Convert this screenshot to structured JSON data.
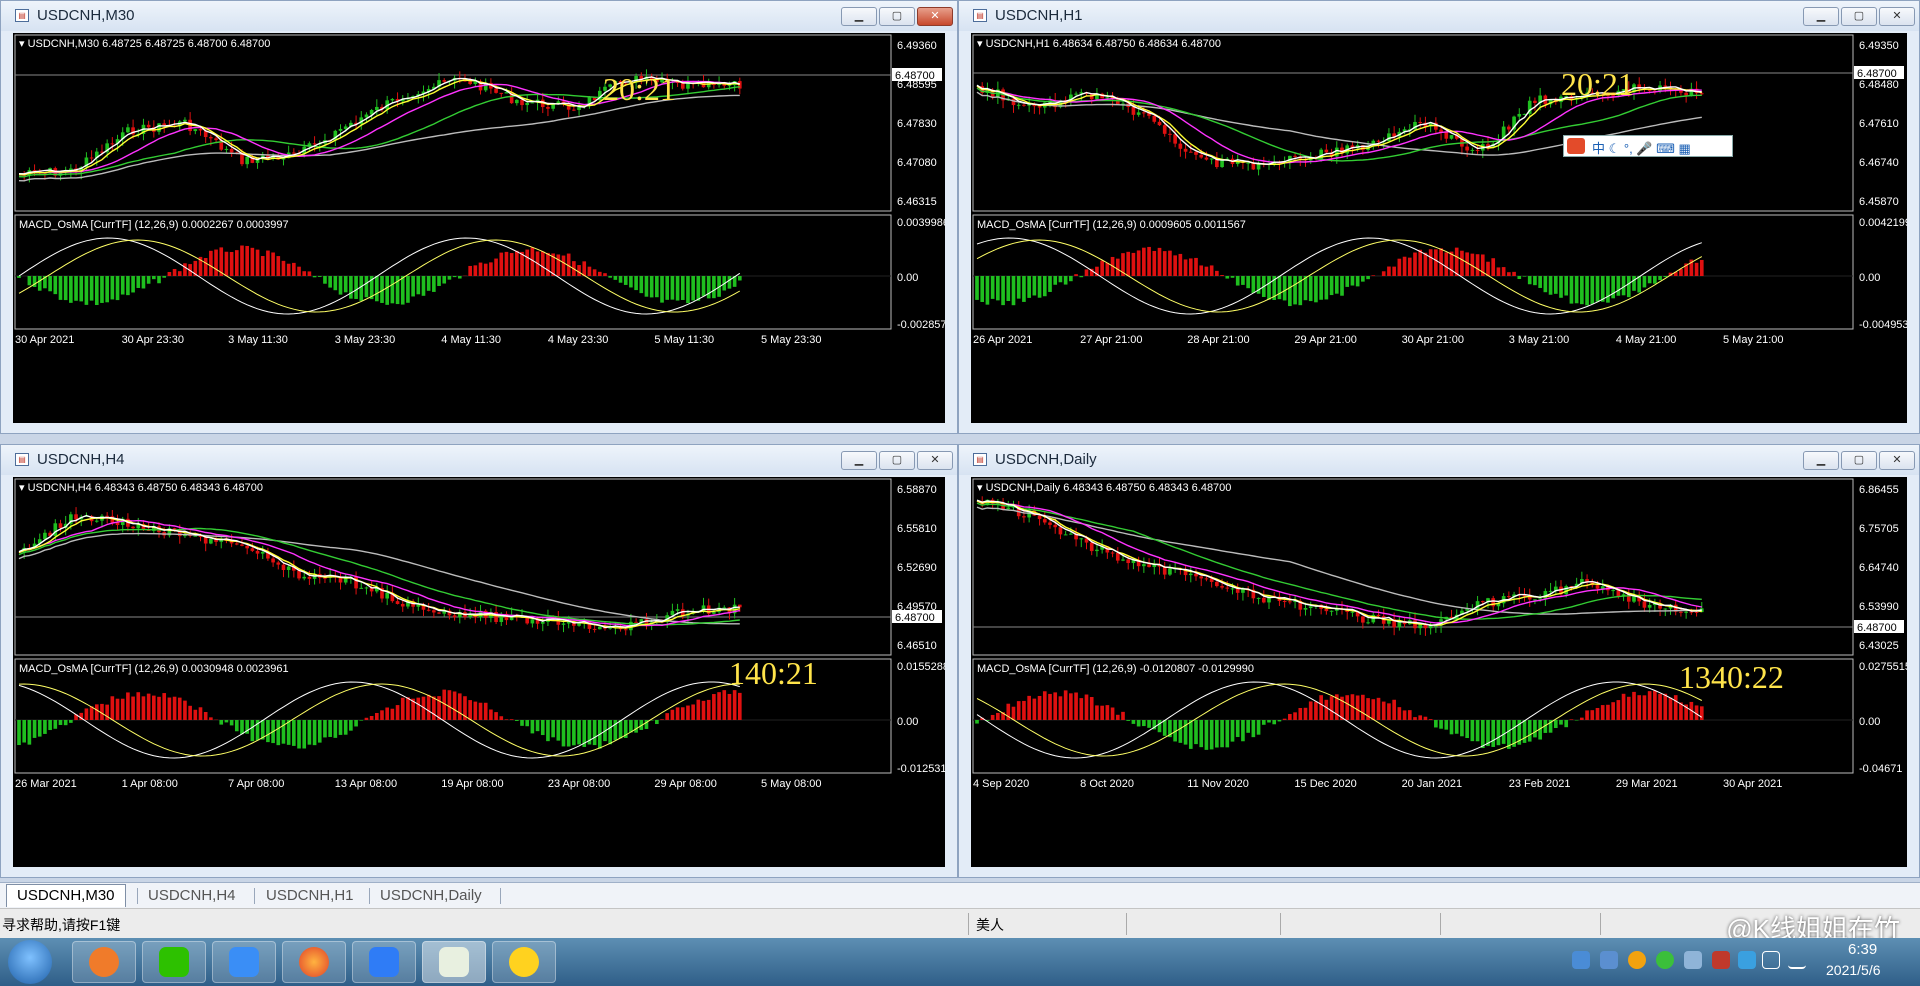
{
  "windows": [
    {
      "title": "USDCNH,M30",
      "active": true,
      "info": "USDCNH,M30  6.48725 6.48725 6.48700 6.48700",
      "price_axis": [
        "6.49360",
        "6.48595",
        "6.47830",
        "6.47080",
        "6.46315"
      ],
      "current_price": "6.48700",
      "big_time": "20:21",
      "macd_info": "MACD_OsMA [CurrTF] (12,26,9) 0.0002267 0.0003997",
      "macd_axis": [
        "0.0039986",
        "0.00",
        "-0.0028573"
      ],
      "time_axis": [
        "30 Apr 2021",
        "30 Apr 23:30",
        "3 May 11:30",
        "3 May 23:30",
        "4 May 11:30",
        "4 May 23:30",
        "5 May 11:30",
        "5 May 23:30"
      ]
    },
    {
      "title": "USDCNH,H1",
      "active": false,
      "info": "USDCNH,H1  6.48634 6.48750 6.48634 6.48700",
      "price_axis": [
        "6.49350",
        "6.48480",
        "6.47610",
        "6.46740",
        "6.45870"
      ],
      "current_price": "6.48700",
      "big_time": "20:21",
      "macd_info": "MACD_OsMA [CurrTF] (12,26,9) 0.0009605 0.0011567",
      "macd_axis": [
        "0.0042199",
        "0.00",
        "-0.0049538"
      ],
      "time_axis": [
        "26 Apr 2021",
        "27 Apr 21:00",
        "28 Apr 21:00",
        "29 Apr 21:00",
        "30 Apr 21:00",
        "3 May 21:00",
        "4 May 21:00",
        "5 May 21:00"
      ]
    },
    {
      "title": "USDCNH,H4",
      "active": false,
      "info": "USDCNH,H4  6.48343 6.48750 6.48343 6.48700",
      "price_axis": [
        "6.58870",
        "6.55810",
        "6.52690",
        "6.49570",
        "6.46510"
      ],
      "current_price": "6.48700",
      "big_time": "140:21",
      "macd_info": "MACD_OsMA [CurrTF] (12,26,9) 0.0030948 0.0023961",
      "macd_axis": [
        "0.0155288",
        "0.00",
        "-0.0125312"
      ],
      "time_axis": [
        "26 Mar 2021",
        "1 Apr 08:00",
        "7 Apr 08:00",
        "13 Apr 08:00",
        "19 Apr 08:00",
        "23 Apr 08:00",
        "29 Apr 08:00",
        "5 May 08:00"
      ]
    },
    {
      "title": "USDCNH,Daily",
      "active": false,
      "info": "USDCNH,Daily  6.48343 6.48750 6.48343 6.48700",
      "price_axis": [
        "6.86455",
        "6.75705",
        "6.64740",
        "6.53990",
        "6.43025"
      ],
      "current_price": "6.48700",
      "big_time": "1340:22",
      "macd_info": "MACD_OsMA [CurrTF] (12,26,9) -0.0120807 -0.0129990",
      "macd_axis": [
        "0.0275515",
        "0.00",
        "-0.04671"
      ],
      "time_axis": [
        "4 Sep 2020",
        "8 Oct 2020",
        "11 Nov 2020",
        "15 Dec 2020",
        "20 Jan 2021",
        "23 Feb 2021",
        "29 Mar 2021",
        "30 Apr 2021"
      ]
    }
  ],
  "tabs": [
    "USDCNH,M30",
    "USDCNH,H4",
    "USDCNH,H1",
    "USDCNH,Daily"
  ],
  "status": {
    "help": "寻求帮助,请按F1键",
    "server": "美人"
  },
  "watermark": "@K线姐姐在竹",
  "clock": {
    "time": "6:39",
    "date": "2021/5/6"
  },
  "colors": {
    "bull": "#1fbf1f",
    "bear": "#e01010",
    "ma_fast": "#ffffff",
    "ma_yellow": "#ffff33",
    "ma_magenta": "#ff33ff",
    "ma_green": "#33cc33",
    "ma_gray": "#bbbbbb",
    "big_time": "#ffe44a"
  }
}
